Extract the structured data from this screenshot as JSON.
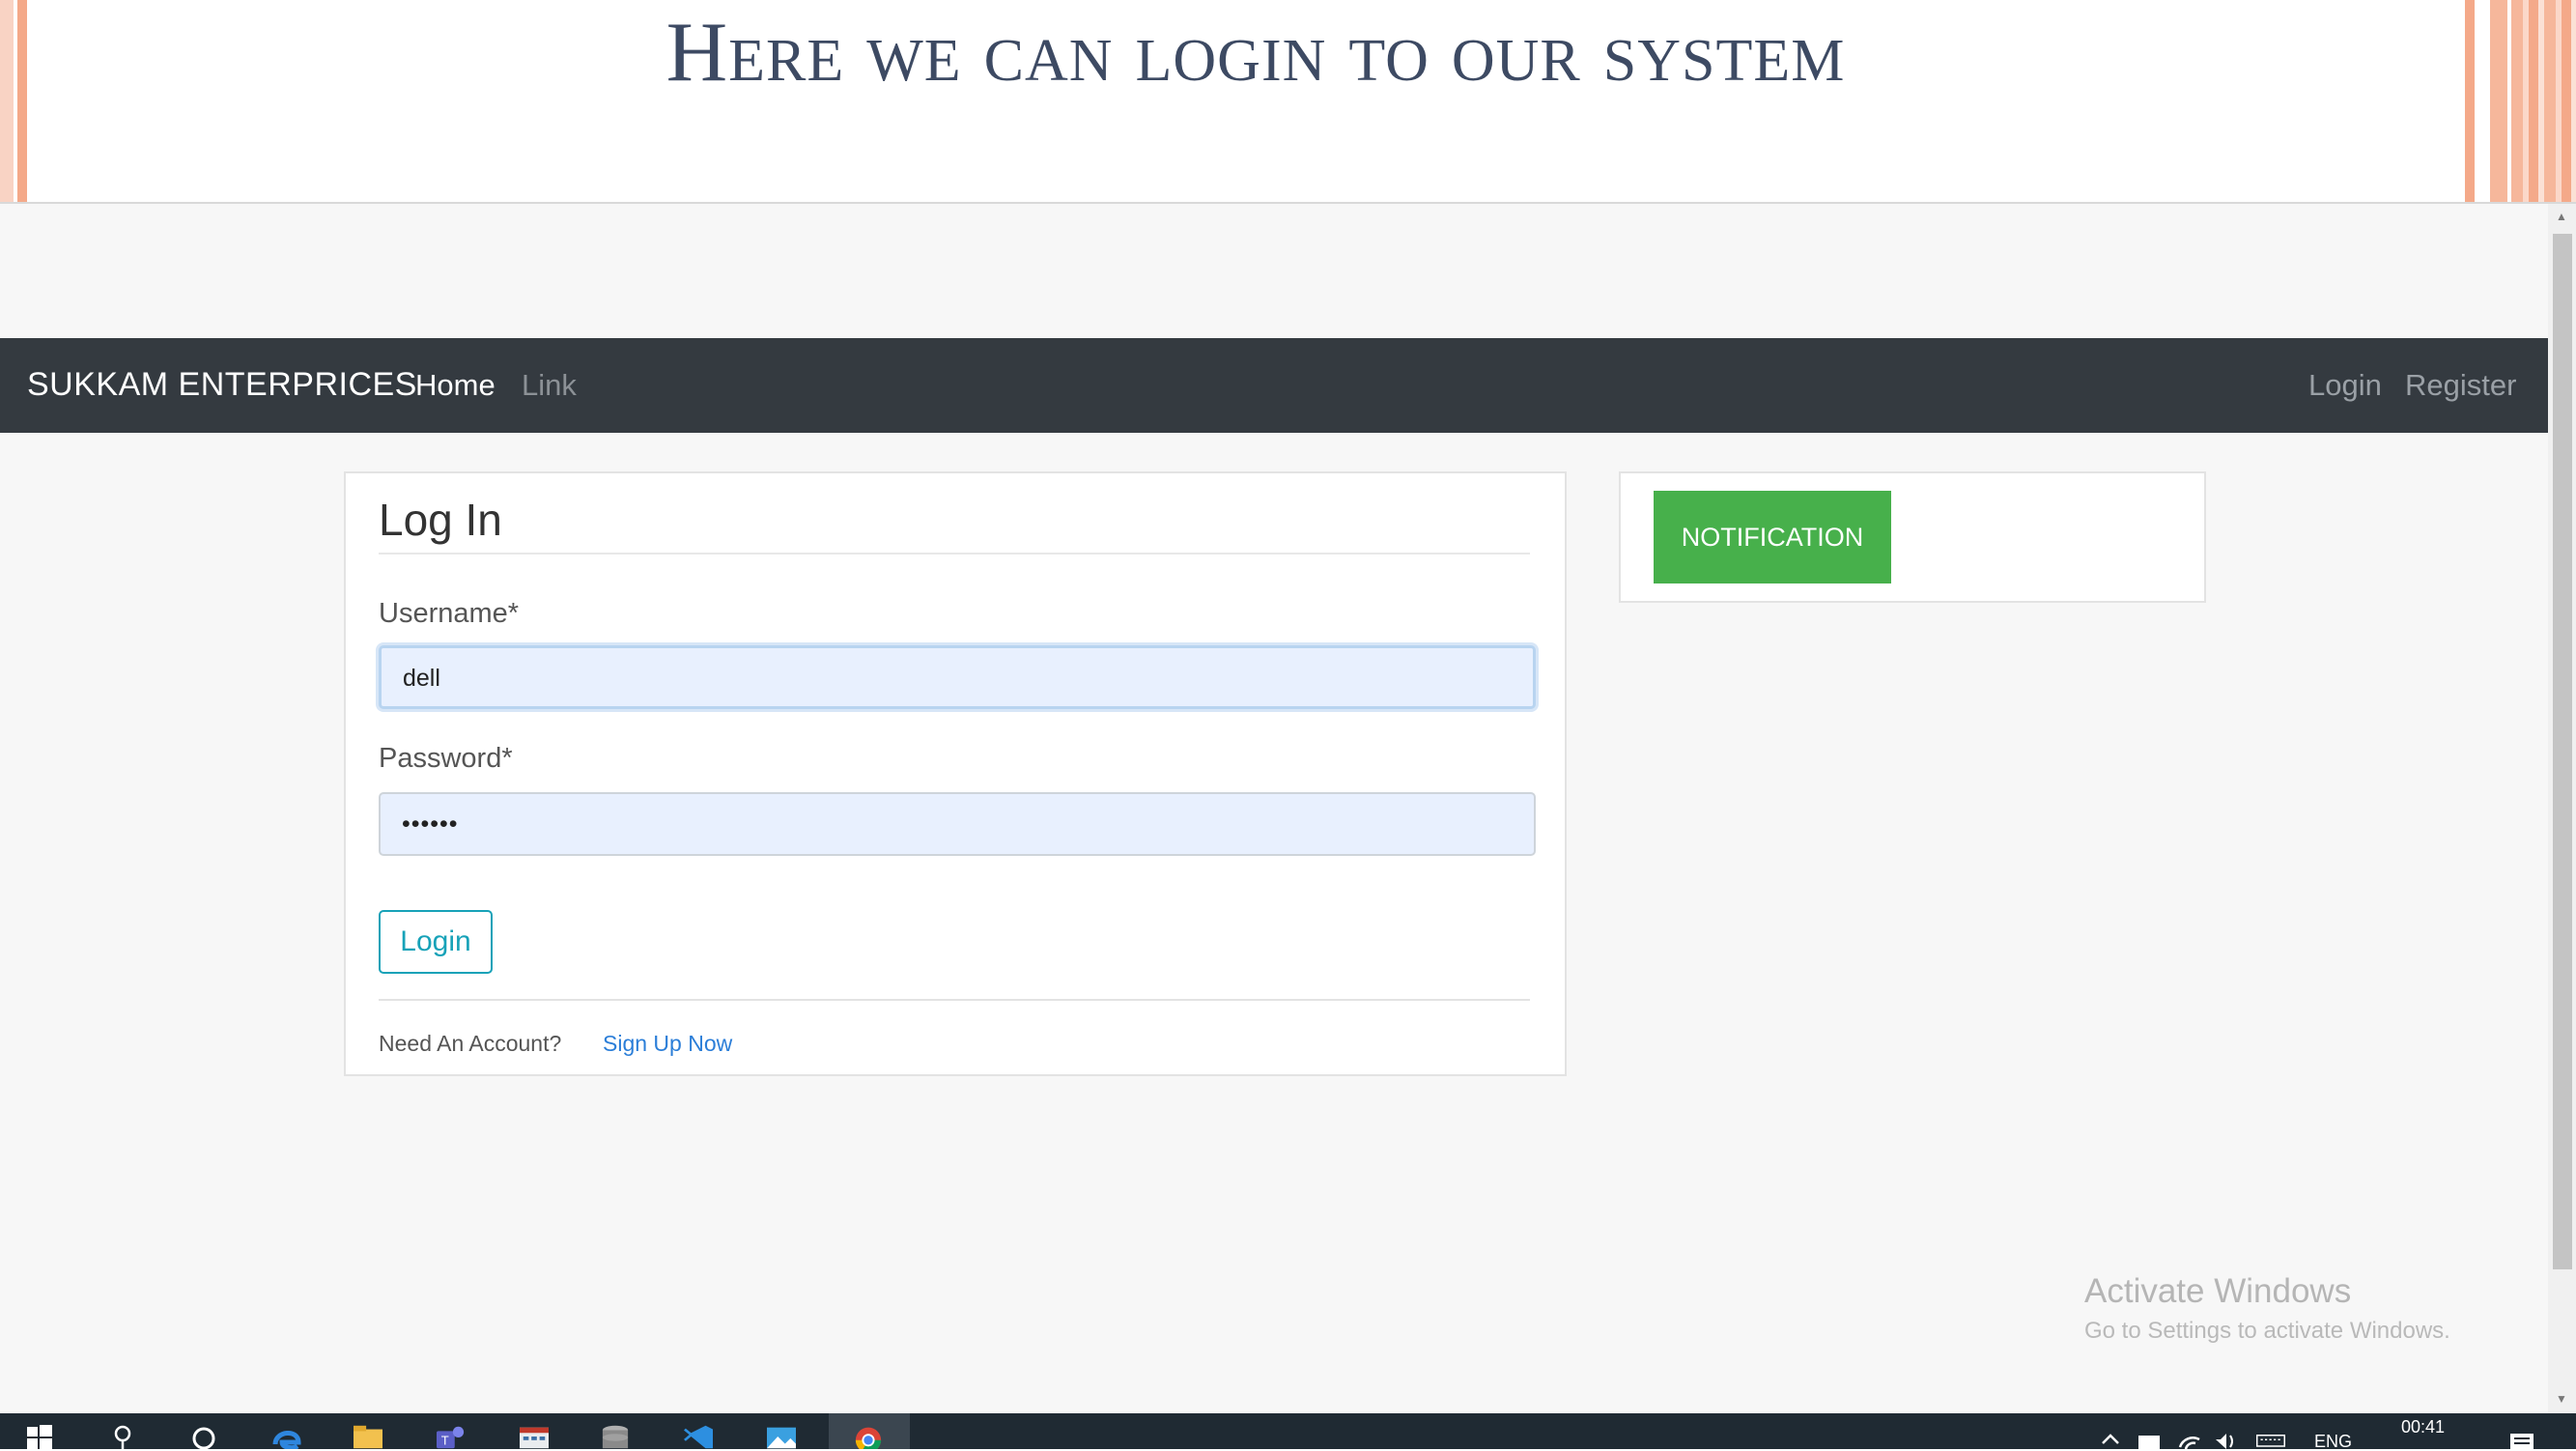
{
  "slide": {
    "title": "Here we can login to our system"
  },
  "navbar": {
    "brand": "SUKKAM ENTERPRICES",
    "home": "Home",
    "link": "Link",
    "login": "Login",
    "register": "Register"
  },
  "login_card": {
    "title": "Log In",
    "username_label": "Username*",
    "username_value": "dell",
    "password_label": "Password*",
    "password_value": "••••••",
    "login_button": "Login",
    "need_account": "Need An Account?",
    "signup_link": "Sign Up Now"
  },
  "notification": {
    "button": "NOTIFICATION"
  },
  "watermark": {
    "title": "Activate Windows",
    "subtitle": "Go to Settings to activate Windows."
  },
  "taskbar": {
    "icons": [
      "windows-start-icon",
      "search-icon",
      "cortana-icon",
      "edge-icon",
      "file-explorer-icon",
      "teams-icon",
      "calendar-app-icon",
      "database-icon",
      "vscode-icon",
      "photos-icon",
      "chrome-icon"
    ],
    "language": "ENG",
    "time": "00:41"
  },
  "colors": {
    "navbar_bg": "#343a40",
    "notification_green": "#47b04b",
    "login_button_accent": "#17a2b8",
    "link_blue": "#2b7ed8",
    "slide_title": "#3d4a63"
  }
}
